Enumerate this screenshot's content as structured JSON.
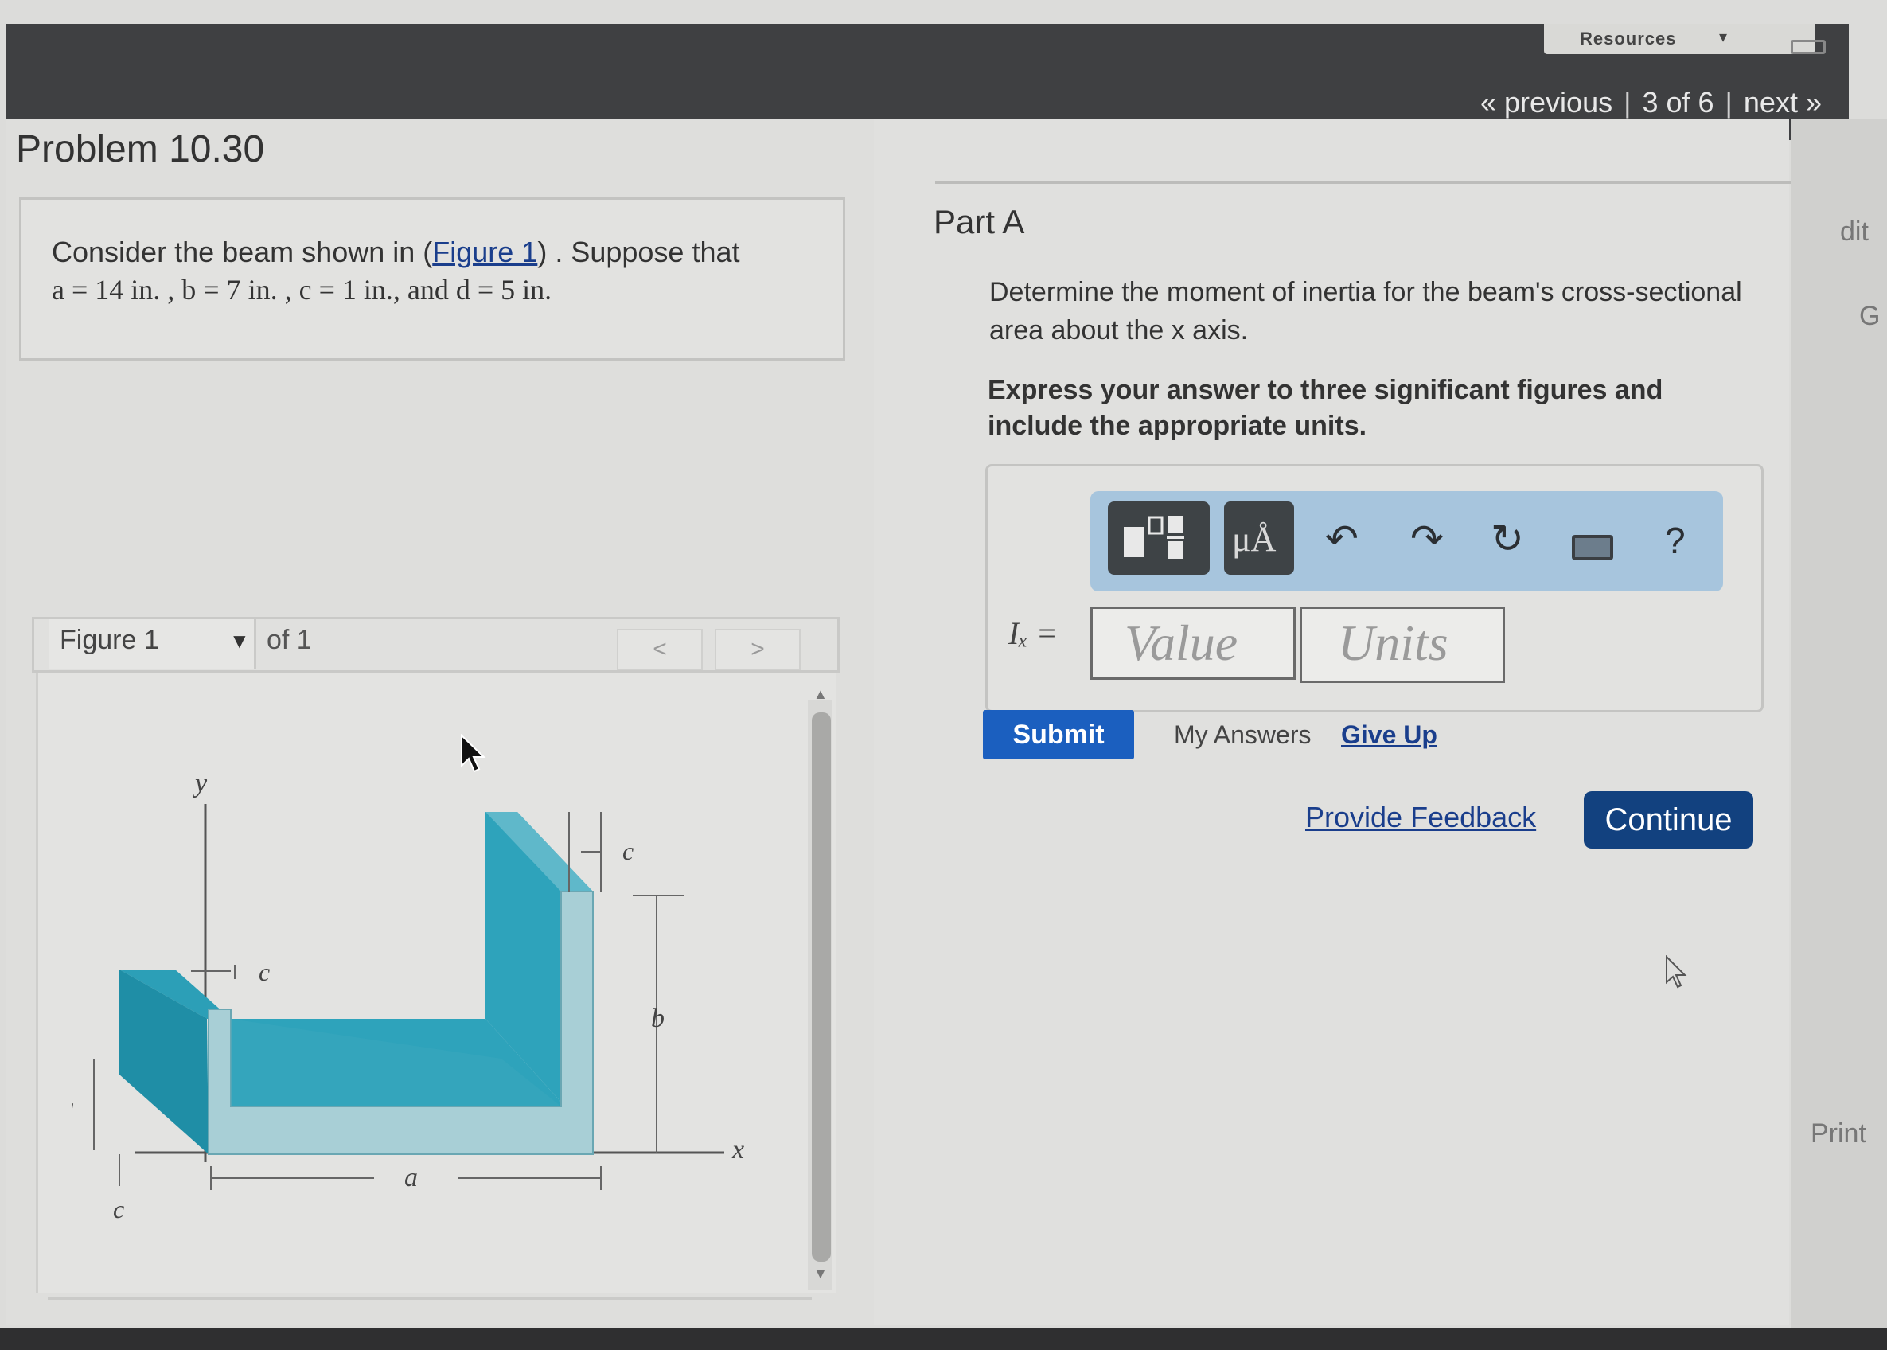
{
  "header": {
    "resources_label": "Resources",
    "nav": {
      "previous": "« previous",
      "position": "3 of 6",
      "next": "next »"
    }
  },
  "problem": {
    "title": "Problem 10.30",
    "statement_prefix": "Consider the beam shown in (",
    "figure_link": "Figure 1",
    "statement_suffix": ") . Suppose that",
    "statement_values": "a = 14  in. , b = 7  in. , c = 1 in., and d = 5  in."
  },
  "figure": {
    "selected": "Figure 1",
    "of_label": "of 1",
    "prev_label": "<",
    "next_label": ">",
    "labels": {
      "y": "y",
      "x": "x",
      "a": "a",
      "b": "b",
      "c_top": "c",
      "c_mid": "c",
      "c_bottom": "c",
      "d": "d"
    },
    "colors": {
      "beam_front": "#3aa7bd",
      "beam_top": "#6fc2d2",
      "beam_face": "#a8cfd6",
      "beam_dark": "#1f8ea6"
    }
  },
  "part": {
    "title": "Part A",
    "question_line1": "Determine the moment of inertia for the beam's cross-sectional",
    "question_line2": "area about the x axis.",
    "instructions_line1": "Express your answer to three significant figures and",
    "instructions_line2": "include the appropriate units."
  },
  "answer": {
    "label": "Iₓ =",
    "value_placeholder": "Value",
    "units_placeholder": "Units",
    "toolbar": {
      "templates_icon": "templates-icon",
      "units_label": "μÅ",
      "undo_icon": "undo-icon",
      "redo_icon": "redo-icon",
      "reset_icon": "reset-icon",
      "keyboard_icon": "keyboard-icon",
      "help_label": "?"
    }
  },
  "actions": {
    "submit": "Submit",
    "my_answers": "My Answers",
    "give_up": "Give Up",
    "provide_feedback": "Provide Feedback",
    "continue": "Continue"
  },
  "side": {
    "edit": "dit",
    "g": "G",
    "print": "Print"
  }
}
